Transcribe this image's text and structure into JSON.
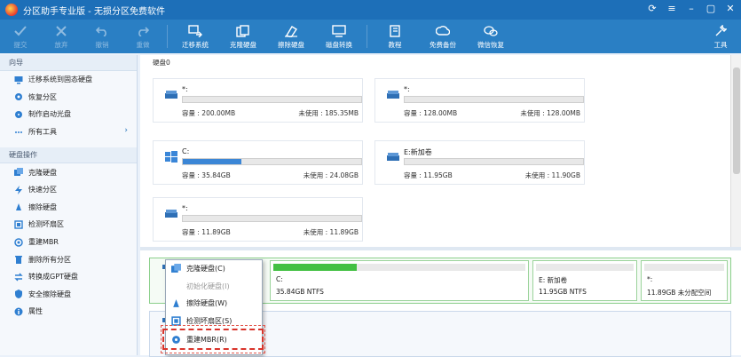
{
  "app": {
    "title": "分区助手专业版 - 无损分区免费软件"
  },
  "toolbar": {
    "items": [
      {
        "label": "提交",
        "icon": "check-icon",
        "enabled": false
      },
      {
        "label": "放弃",
        "icon": "discard-icon",
        "enabled": false
      },
      {
        "label": "撤销",
        "icon": "undo-icon",
        "enabled": false
      },
      {
        "label": "重做",
        "icon": "redo-icon",
        "enabled": false
      },
      {
        "label": "迁移系统",
        "icon": "migrate-icon",
        "enabled": true
      },
      {
        "label": "克隆硬盘",
        "icon": "clone-icon",
        "enabled": true
      },
      {
        "label": "擦除硬盘",
        "icon": "wipe-icon",
        "enabled": true
      },
      {
        "label": "磁盘转换",
        "icon": "convert-icon",
        "enabled": true
      },
      {
        "label": "教程",
        "icon": "book-icon",
        "enabled": true
      },
      {
        "label": "免费备份",
        "icon": "backup-icon",
        "enabled": true
      },
      {
        "label": "微信恢复",
        "icon": "wechat-icon",
        "enabled": true
      },
      {
        "label": "工具",
        "icon": "tools-icon",
        "enabled": true
      }
    ]
  },
  "sidebar": {
    "guide_heading": "向导",
    "guide_items": [
      {
        "label": "迁移系统到固态硬盘",
        "icon": "migrate-icon"
      },
      {
        "label": "恢复分区",
        "icon": "restore-icon"
      },
      {
        "label": "制作启动光盘",
        "icon": "boot-disc-icon"
      },
      {
        "label": "所有工具",
        "icon": "more-icon"
      }
    ],
    "disk_heading": "硬盘操作",
    "disk_items": [
      {
        "label": "克隆硬盘",
        "icon": "clone-icon"
      },
      {
        "label": "快速分区",
        "icon": "quick-partition-icon"
      },
      {
        "label": "擦除硬盘",
        "icon": "wipe-icon"
      },
      {
        "label": "检测坏扇区",
        "icon": "bad-sector-icon"
      },
      {
        "label": "重建MBR",
        "icon": "rebuild-mbr-icon"
      },
      {
        "label": "删除所有分区",
        "icon": "delete-all-icon"
      },
      {
        "label": "转换成GPT硬盘",
        "icon": "gpt-icon"
      },
      {
        "label": "安全擦除硬盘",
        "icon": "secure-erase-icon"
      },
      {
        "label": "属性",
        "icon": "properties-icon"
      }
    ]
  },
  "main": {
    "disk_title": "硬盘0",
    "cards": [
      {
        "name": "*:",
        "capacity": "容量 : 200.00MB",
        "free": "未使用 : 185.35MB",
        "fill": 0.0,
        "icon": "drive-icon"
      },
      {
        "name": "*:",
        "capacity": "容量 : 128.00MB",
        "free": "未使用 : 128.00MB",
        "fill": 0.0,
        "icon": "drive-icon"
      },
      {
        "name": "C:",
        "capacity": "容量 : 35.84GB",
        "free": "未使用 : 24.08GB",
        "fill": 0.33,
        "icon": "windows-icon"
      },
      {
        "name": "E:新加卷",
        "capacity": "容量 : 11.95GB",
        "free": "未使用 : 11.90GB",
        "fill": 0.0,
        "icon": "drive-icon"
      },
      {
        "name": "*:",
        "capacity": "容量 : 11.89GB",
        "free": "未使用 : 11.89GB",
        "fill": 0.0,
        "icon": "drive-icon"
      }
    ],
    "diskmap": [
      {
        "title": "C:",
        "info": "35.84GB NTFS",
        "fill": 0.33
      },
      {
        "title": "E: 新加卷",
        "info": "11.95GB NTFS",
        "fill": 0.0
      },
      {
        "title": "*:",
        "info": "11.89GB 未分配空间",
        "fill": 0.0
      }
    ]
  },
  "context_menu": {
    "items": [
      {
        "label": "克隆硬盘(C)",
        "icon": "clone-icon",
        "enabled": true
      },
      {
        "label": "初始化硬盘(I)",
        "icon": "init-icon",
        "enabled": false
      },
      {
        "label": "擦除硬盘(W)",
        "icon": "wipe-icon",
        "enabled": true
      },
      {
        "label": "检测坏扇区(S)",
        "icon": "bad-sector-icon",
        "enabled": true
      },
      {
        "label": "重建MBR(R)",
        "icon": "rebuild-mbr-icon",
        "enabled": true,
        "highlighted": true
      }
    ]
  }
}
